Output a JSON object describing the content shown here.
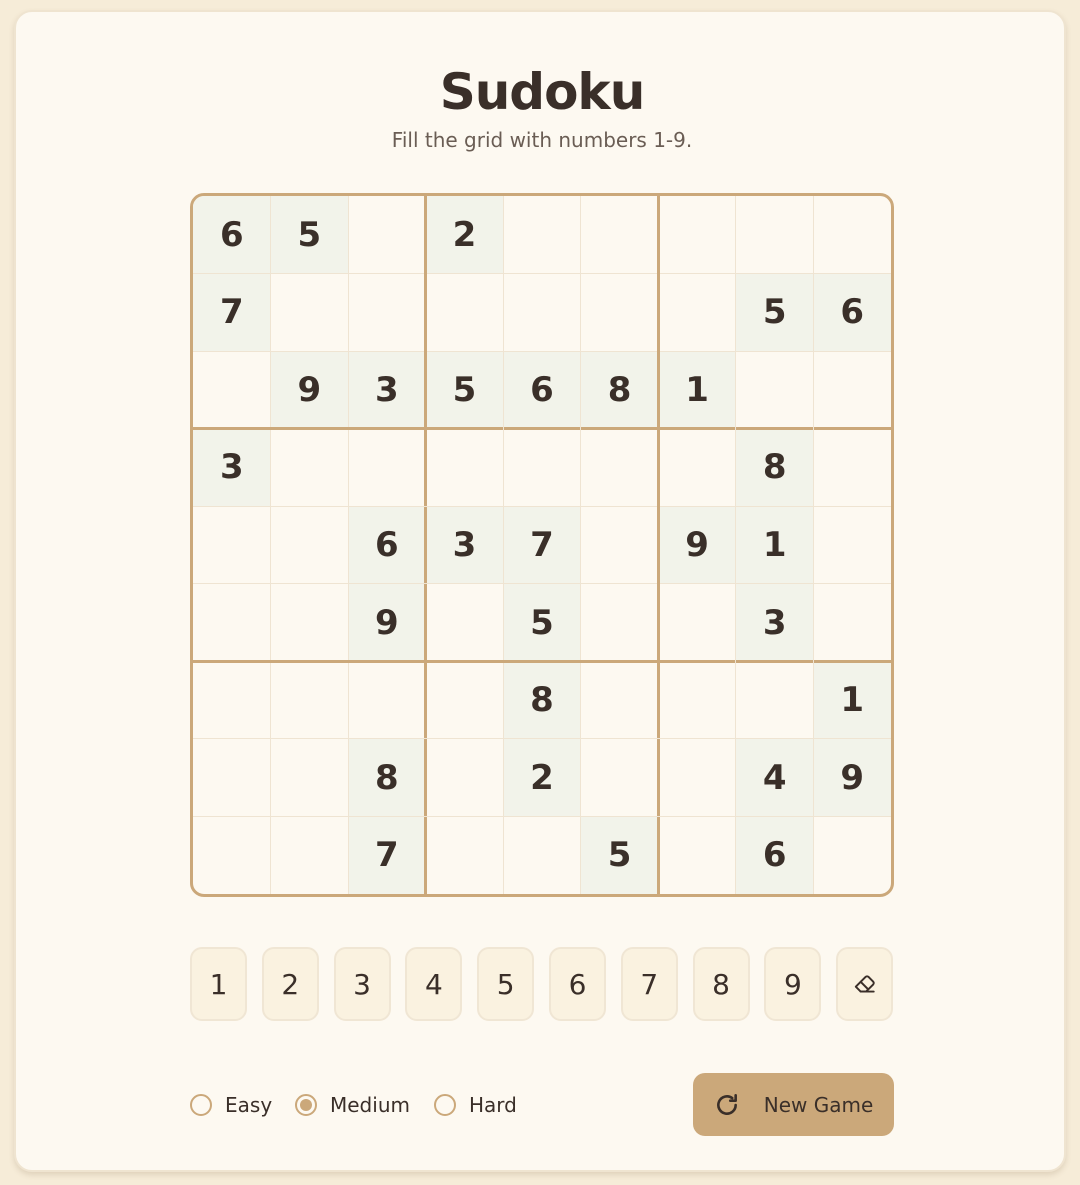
{
  "header": {
    "title": "Sudoku",
    "subtitle": "Fill the grid with numbers 1-9."
  },
  "board": {
    "rows": [
      [
        "6",
        "5",
        "",
        "2",
        "",
        "",
        "",
        "",
        ""
      ],
      [
        "7",
        "",
        "",
        "",
        "",
        "",
        "",
        "5",
        "6"
      ],
      [
        "",
        "9",
        "3",
        "5",
        "6",
        "8",
        "1",
        "",
        ""
      ],
      [
        "3",
        "",
        "",
        "",
        "",
        "",
        "",
        "8",
        ""
      ],
      [
        "",
        "",
        "6",
        "3",
        "7",
        "",
        "9",
        "1",
        ""
      ],
      [
        "",
        "",
        "9",
        "",
        "5",
        "",
        "",
        "3",
        ""
      ],
      [
        "",
        "",
        "",
        "",
        "8",
        "",
        "",
        "",
        "1"
      ],
      [
        "",
        "",
        "8",
        "",
        "2",
        "",
        "",
        "4",
        "9"
      ],
      [
        "",
        "",
        "7",
        "",
        "",
        "5",
        "",
        "6",
        ""
      ]
    ]
  },
  "numpad": {
    "keys": [
      "1",
      "2",
      "3",
      "4",
      "5",
      "6",
      "7",
      "8",
      "9"
    ],
    "erase_icon": "eraser-icon"
  },
  "difficulty": {
    "options": [
      "Easy",
      "Medium",
      "Hard"
    ],
    "selected": "Medium"
  },
  "actions": {
    "new_game_label": "New Game",
    "new_game_icon": "refresh-icon"
  },
  "colors": {
    "accent": "#cba87a",
    "given_cell": "#f2f3ea",
    "card_background": "#fdf9f1",
    "page_background": "#f6ecd8",
    "text": "#3a2f29"
  }
}
